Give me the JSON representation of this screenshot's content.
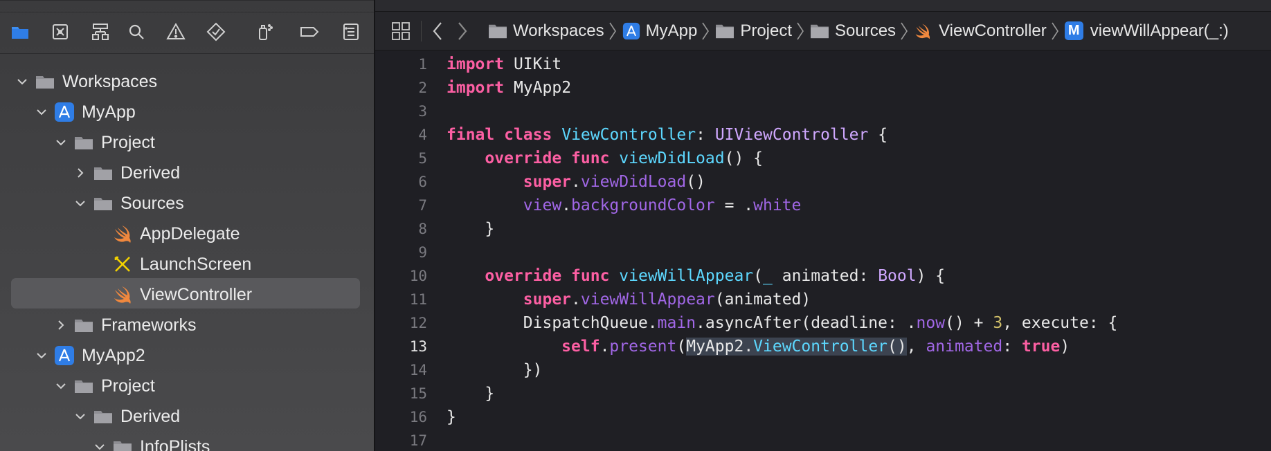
{
  "navigator": {
    "toolbar_icons": [
      "folder-icon",
      "source-control-icon",
      "hierarchy-icon",
      "search-icon",
      "warning-icon",
      "test-icon",
      "debug-icon",
      "breakpoint-icon",
      "report-icon"
    ],
    "tree": [
      {
        "label": "Workspaces",
        "icon": "folder-icon",
        "expanded": true
      },
      {
        "label": "MyApp",
        "icon": "app-icon",
        "expanded": true
      },
      {
        "label": "Project",
        "icon": "folder-icon",
        "expanded": true
      },
      {
        "label": "Derived",
        "icon": "folder-icon",
        "expanded": false
      },
      {
        "label": "Sources",
        "icon": "folder-icon",
        "expanded": true
      },
      {
        "label": "AppDelegate",
        "icon": "swift-icon"
      },
      {
        "label": "LaunchScreen",
        "icon": "storyboard-icon"
      },
      {
        "label": "ViewController",
        "icon": "swift-icon",
        "selected": true
      },
      {
        "label": "Frameworks",
        "icon": "folder-icon",
        "expanded": false
      },
      {
        "label": "MyApp2",
        "icon": "app-icon",
        "expanded": true
      },
      {
        "label": "Project",
        "icon": "folder-icon",
        "expanded": true
      },
      {
        "label": "Derived",
        "icon": "folder-icon",
        "expanded": true
      },
      {
        "label": "InfoPlists",
        "icon": "folder-icon",
        "expanded": true
      }
    ]
  },
  "jumpbar": {
    "crumbs": [
      "Workspaces",
      "MyApp",
      "Project",
      "Sources",
      "ViewController",
      "viewWillAppear(_:)"
    ],
    "method_badge": "M"
  },
  "editor": {
    "current_line": 13,
    "line_numbers": [
      "1",
      "2",
      "3",
      "4",
      "5",
      "6",
      "7",
      "8",
      "9",
      "10",
      "11",
      "12",
      "13",
      "14",
      "15",
      "16",
      "17"
    ],
    "tokens": {
      "import": "import",
      "uikit": "UIKit",
      "myapp2": "MyApp2",
      "final": "final",
      "class": "class",
      "viewcontroller": "ViewController",
      "colon": ":",
      "uiviewcontroller": "UIViewController",
      "open_brace": " {",
      "override": "override",
      "func": "func",
      "viewdidload": "viewDidLoad",
      "parens_brace": "() {",
      "super": "super",
      "dot": ".",
      "parens": "()",
      "view": "view",
      "backgroundcolor": "backgroundColor",
      "assign": " = .",
      "white": "white",
      "close_brace": "}",
      "viewwillappear": "viewWillAppear",
      "param_open": "(",
      "underscore": "_",
      "animated_decl": " animated: ",
      "bool": "Bool",
      "close_paren_brace": ") {",
      "animated_arg": "(animated)",
      "dispatchqueue": "DispatchQueue",
      "main": "main",
      "asyncafter": ".asyncAfter(deadline: .",
      "now": "now",
      "plus": "() + ",
      "three": "3",
      "execute": ", execute: {",
      "self": "self",
      "present": "present",
      "vc_type": "ViewController",
      "comma_space": ", ",
      "animated_label": "animated",
      "colon_space": ": ",
      "true": "true",
      "close_paren": ")",
      "close_brace_paren": "})"
    }
  }
}
